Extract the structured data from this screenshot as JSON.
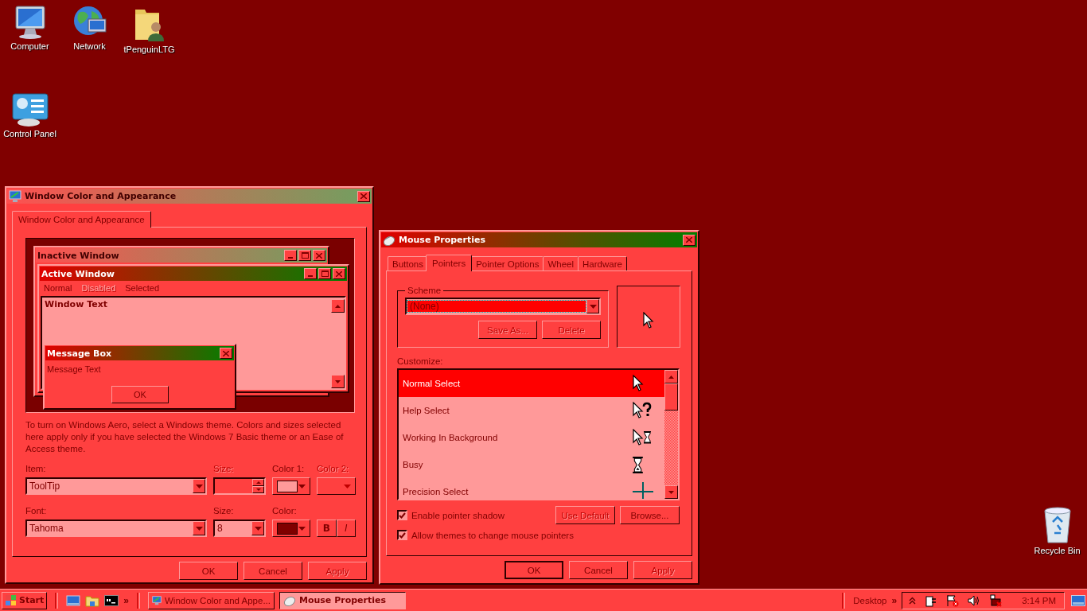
{
  "desktop": {
    "icons": [
      {
        "kind": "computer",
        "label": "Computer"
      },
      {
        "kind": "network",
        "label": "Network"
      },
      {
        "kind": "folder",
        "label": "tPenguinLTG"
      },
      {
        "kind": "control-panel",
        "label": "Control Panel"
      },
      {
        "kind": "recycle-bin",
        "label": "Recycle Bin"
      }
    ]
  },
  "appearance_window": {
    "title": "Window Color and Appearance",
    "active": false,
    "tabs": [
      {
        "label": "Window Color and Appearance",
        "selected": true
      }
    ],
    "preview": {
      "inactive_title": "Inactive Window",
      "active_title": "Active Window",
      "menu": [
        {
          "label": "Normal",
          "disabled": false
        },
        {
          "label": "Disabled",
          "disabled": true
        },
        {
          "label": "Selected",
          "disabled": false
        }
      ],
      "window_text": "Window Text",
      "message_box": {
        "title": "Message Box",
        "text": "Message Text",
        "button": "OK"
      }
    },
    "description": "To turn on Windows Aero, select a Windows theme.  Colors and sizes selected here apply only if you have selected the Windows 7 Basic theme or an Ease of Access theme.",
    "item": {
      "label": "Item:",
      "value": "ToolTip"
    },
    "item_size": {
      "label": "Size:",
      "disabled": true
    },
    "color_1": {
      "label": "Color 1:",
      "color": "#ff9999"
    },
    "color_2": {
      "label": "Color 2:",
      "disabled": true
    },
    "font": {
      "label": "Font:",
      "value": "Tahoma"
    },
    "font_size": {
      "label": "Size:",
      "value": "8"
    },
    "font_color": {
      "label": "Color:",
      "color": "#800000"
    },
    "bold": {
      "label": "B"
    },
    "italic": {
      "label": "I"
    },
    "buttons": [
      {
        "label": "OK",
        "disabled": false
      },
      {
        "label": "Cancel",
        "disabled": false
      },
      {
        "label": "Apply",
        "disabled": true
      }
    ]
  },
  "mouse_window": {
    "title": "Mouse Properties",
    "active": true,
    "tabs": [
      {
        "label": "Buttons",
        "selected": false
      },
      {
        "label": "Pointers",
        "selected": true
      },
      {
        "label": "Pointer Options",
        "selected": false
      },
      {
        "label": "Wheel",
        "selected": false
      },
      {
        "label": "Hardware",
        "selected": false
      }
    ],
    "scheme": {
      "label": "Scheme",
      "value": "(None)",
      "buttons": [
        {
          "label": "Save As...",
          "disabled": true
        },
        {
          "label": "Delete",
          "disabled": true
        }
      ]
    },
    "customize_label": "Customize:",
    "pointers": [
      {
        "label": "Normal Select",
        "kind": "arrow",
        "selected": true
      },
      {
        "label": "Help Select",
        "kind": "help",
        "selected": false
      },
      {
        "label": "Working In Background",
        "kind": "working",
        "selected": false
      },
      {
        "label": "Busy",
        "kind": "busy",
        "selected": false
      },
      {
        "label": "Precision Select",
        "kind": "cross",
        "selected": false
      }
    ],
    "options": [
      {
        "label": "Enable pointer shadow",
        "checked": true
      },
      {
        "label": "Allow themes to change mouse pointers",
        "checked": true
      }
    ],
    "list_buttons": [
      {
        "label": "Use Default",
        "disabled": true
      },
      {
        "label": "Browse...",
        "disabled": false
      }
    ],
    "buttons": [
      {
        "label": "OK",
        "disabled": false
      },
      {
        "label": "Cancel",
        "disabled": false
      },
      {
        "label": "Apply",
        "disabled": true
      }
    ]
  },
  "taskbar": {
    "start": "Start",
    "quick_launch": [
      {
        "kind": "desktop"
      },
      {
        "kind": "explorer"
      },
      {
        "kind": "console"
      }
    ],
    "quick_more": "»",
    "tasks": [
      {
        "label": "Window Color and Appe...",
        "kind": "appearance",
        "selected": false
      },
      {
        "label": "Mouse Properties",
        "kind": "mouse",
        "selected": true
      }
    ],
    "toolbar": "Desktop",
    "toolbar_more": "»",
    "tray": [
      {
        "kind": "show-hidden"
      },
      {
        "kind": "power"
      },
      {
        "kind": "flag"
      },
      {
        "kind": "volume"
      },
      {
        "kind": "network"
      }
    ],
    "clock": "3:14 PM"
  }
}
